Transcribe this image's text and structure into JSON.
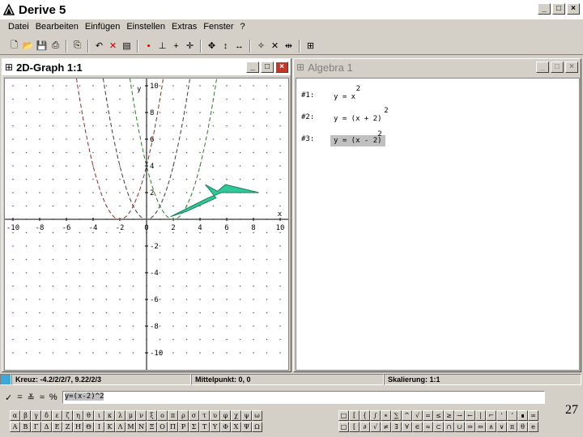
{
  "app": {
    "title": "Derive 5"
  },
  "menu": [
    "Datei",
    "Bearbeiten",
    "Einfügen",
    "Einstellen",
    "Extras",
    "Fenster",
    "?"
  ],
  "graph_window": {
    "title": "2D-Graph 1:1",
    "axis": {
      "x_label": "x",
      "y_label": "y",
      "x_ticks": [
        "-10",
        "-8",
        "-6",
        "-4",
        "-2",
        "0",
        "2",
        "4",
        "6",
        "8",
        "10"
      ],
      "y_ticks": [
        "10",
        "8",
        "6",
        "4",
        "2",
        "-2",
        "-4",
        "-6",
        "-8",
        "-10"
      ],
      "xlim": [
        -10,
        10
      ],
      "ylim": [
        -10,
        10
      ]
    },
    "curve_colors": {
      "y=x^2": "#3a3a3a",
      "y=(x+2)^2": "#8b2a2a",
      "y=(x-2)^2": "#2a7a2a"
    },
    "arrow_color": "#2fc99a"
  },
  "algebra_window": {
    "title": "Algebra 1",
    "expressions": [
      {
        "num": "#1:",
        "text": "y = x",
        "exp": "2"
      },
      {
        "num": "#2:",
        "text": "y = (x + 2)",
        "exp": "2"
      },
      {
        "num": "#3:",
        "text": "y = (x - 2)",
        "exp": "2"
      }
    ]
  },
  "status": {
    "cross": "Kreuz: -4.2/2/2/7, 9.22/2/3",
    "center": "Mittelpunkt: 0, 0",
    "scale": "Skalierung: 1:1"
  },
  "input": {
    "value": "y=(x-2)^2"
  },
  "greek_row1": [
    "α",
    "β",
    "γ",
    "δ",
    "ε",
    "ζ",
    "η",
    "θ",
    "ι",
    "κ",
    "λ",
    "μ",
    "ν",
    "ξ",
    "ο",
    "π",
    "ρ",
    "σ",
    "τ",
    "υ",
    "φ",
    "χ",
    "ψ",
    "ω"
  ],
  "greek_row2": [
    "Α",
    "Β",
    "Γ",
    "Δ",
    "Ε",
    "Ζ",
    "Η",
    "Θ",
    "Ι",
    "Κ",
    "Λ",
    "Μ",
    "Ν",
    "Ξ",
    "Ο",
    "Π",
    "Ρ",
    "Σ",
    "Τ",
    "Υ",
    "Φ",
    "Χ",
    "Ψ",
    "Ω"
  ],
  "sym_row1": [
    "□",
    "[",
    "{",
    "∫",
    "∗",
    "∑",
    "^",
    "√",
    "=",
    "≤",
    "≥",
    "→",
    "←",
    "|",
    "⌐",
    "'",
    "‘",
    "∎",
    "∞"
  ],
  "sym_row2": [
    "□",
    "[",
    "∂",
    "√",
    "≠",
    "∃",
    "∀",
    "∈",
    "≈",
    "⊂",
    "∩",
    "∪",
    "⇒",
    "⇔",
    "∧",
    "∨",
    "π",
    "θ",
    "e"
  ],
  "page_number": "27"
}
